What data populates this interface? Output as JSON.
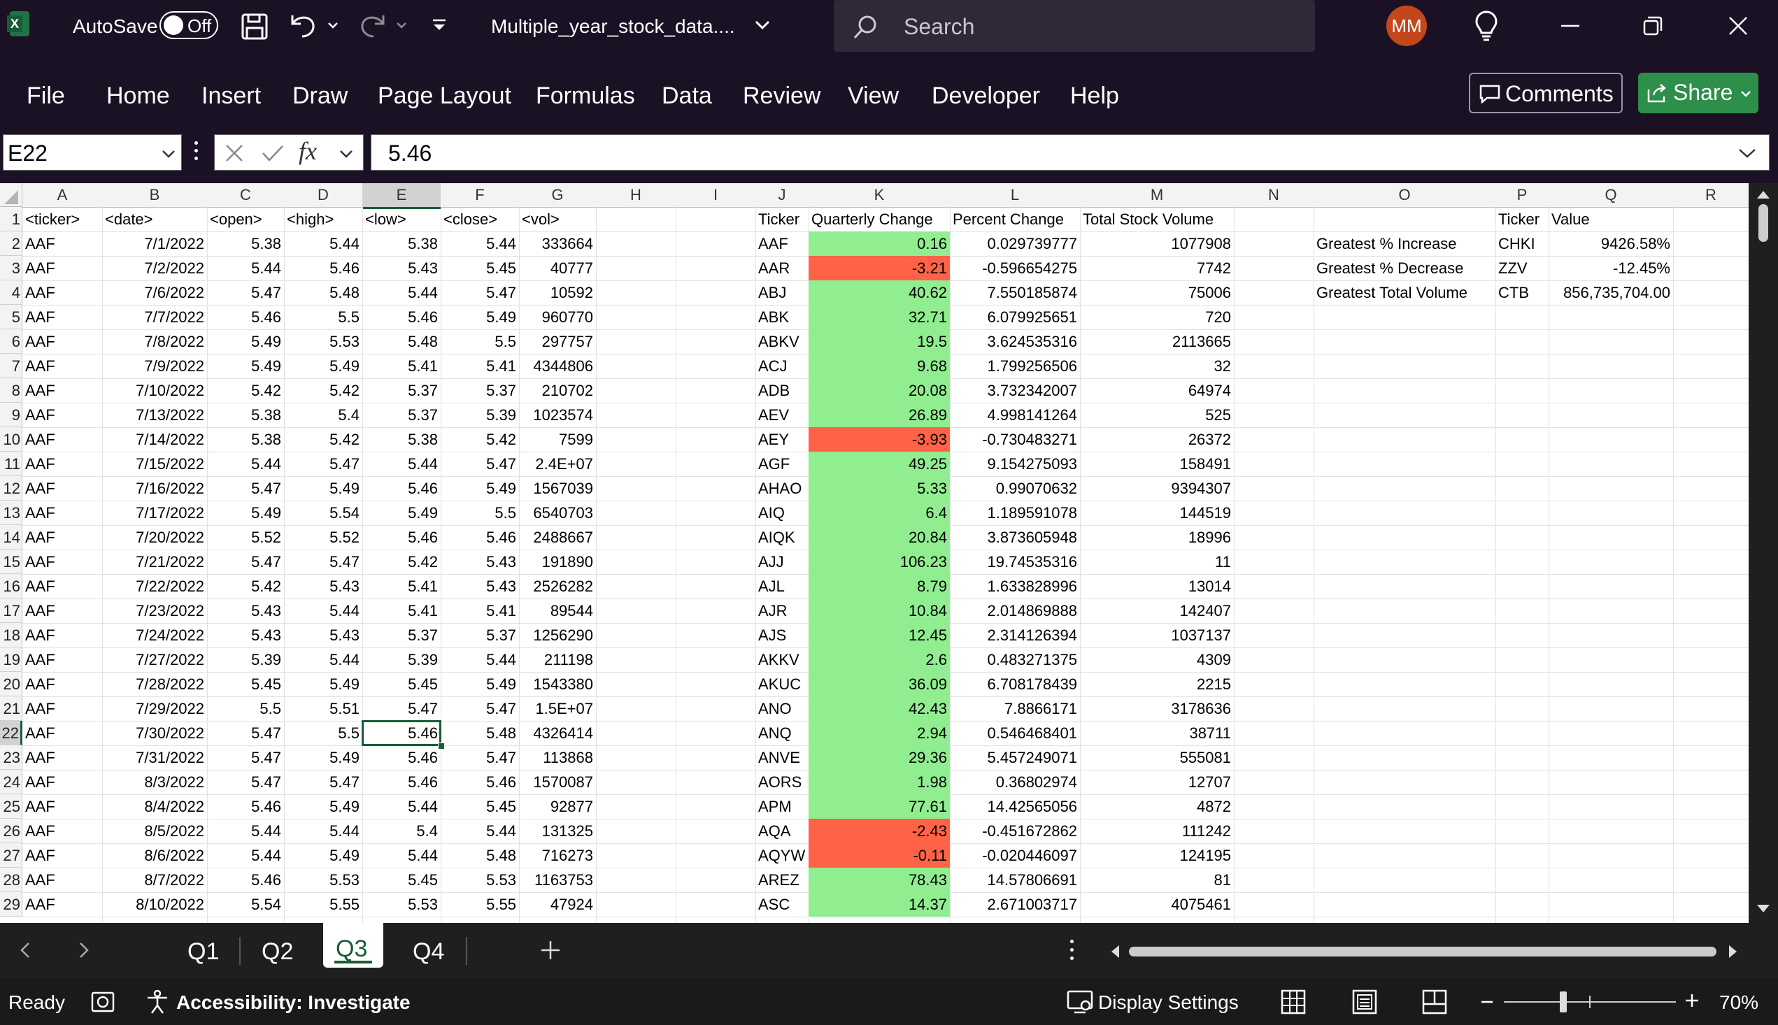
{
  "titlebar": {
    "autosave_label": "AutoSave",
    "autosave_state": "Off",
    "filename": "Multiple_year_stock_data....",
    "search_placeholder": "Search",
    "avatar_initials": "MM"
  },
  "ribbon": {
    "menu": [
      "File",
      "Home",
      "Insert",
      "Draw",
      "Page Layout",
      "Formulas",
      "Data",
      "Review",
      "View",
      "Developer",
      "Help"
    ],
    "comments_label": "Comments",
    "share_label": "Share"
  },
  "formula_bar": {
    "name_box": "E22",
    "fx": "fx",
    "value": "5.46"
  },
  "columns": [
    "A",
    "B",
    "C",
    "D",
    "E",
    "F",
    "G",
    "H",
    "I",
    "J",
    "K",
    "L",
    "M",
    "N",
    "O",
    "P",
    "Q",
    "R"
  ],
  "rows": [
    "1",
    "2",
    "3",
    "4",
    "5",
    "6",
    "7",
    "8",
    "9",
    "10",
    "11",
    "12",
    "13",
    "14",
    "15",
    "16",
    "17",
    "18",
    "19",
    "20",
    "21",
    "22",
    "23",
    "24",
    "25",
    "26",
    "27",
    "28",
    "29"
  ],
  "raw_headers": [
    "<ticker>",
    "<date>",
    "<open>",
    "<high>",
    "<low>",
    "<close>",
    "<vol>"
  ],
  "raw_data": [
    [
      "AAF",
      "7/1/2022",
      "5.38",
      "5.44",
      "5.38",
      "5.44",
      "333664"
    ],
    [
      "AAF",
      "7/2/2022",
      "5.44",
      "5.46",
      "5.43",
      "5.45",
      "40777"
    ],
    [
      "AAF",
      "7/6/2022",
      "5.47",
      "5.48",
      "5.44",
      "5.47",
      "10592"
    ],
    [
      "AAF",
      "7/7/2022",
      "5.46",
      "5.5",
      "5.46",
      "5.49",
      "960770"
    ],
    [
      "AAF",
      "7/8/2022",
      "5.49",
      "5.53",
      "5.48",
      "5.5",
      "297757"
    ],
    [
      "AAF",
      "7/9/2022",
      "5.49",
      "5.49",
      "5.41",
      "5.41",
      "4344806"
    ],
    [
      "AAF",
      "7/10/2022",
      "5.42",
      "5.42",
      "5.37",
      "5.37",
      "210702"
    ],
    [
      "AAF",
      "7/13/2022",
      "5.38",
      "5.4",
      "5.37",
      "5.39",
      "1023574"
    ],
    [
      "AAF",
      "7/14/2022",
      "5.38",
      "5.42",
      "5.38",
      "5.42",
      "7599"
    ],
    [
      "AAF",
      "7/15/2022",
      "5.44",
      "5.47",
      "5.44",
      "5.47",
      "2.4E+07"
    ],
    [
      "AAF",
      "7/16/2022",
      "5.47",
      "5.49",
      "5.46",
      "5.49",
      "1567039"
    ],
    [
      "AAF",
      "7/17/2022",
      "5.49",
      "5.54",
      "5.49",
      "5.5",
      "6540703"
    ],
    [
      "AAF",
      "7/20/2022",
      "5.52",
      "5.52",
      "5.46",
      "5.46",
      "2488667"
    ],
    [
      "AAF",
      "7/21/2022",
      "5.47",
      "5.47",
      "5.42",
      "5.43",
      "191890"
    ],
    [
      "AAF",
      "7/22/2022",
      "5.42",
      "5.43",
      "5.41",
      "5.43",
      "2526282"
    ],
    [
      "AAF",
      "7/23/2022",
      "5.43",
      "5.44",
      "5.41",
      "5.41",
      "89544"
    ],
    [
      "AAF",
      "7/24/2022",
      "5.43",
      "5.43",
      "5.37",
      "5.37",
      "1256290"
    ],
    [
      "AAF",
      "7/27/2022",
      "5.39",
      "5.44",
      "5.39",
      "5.44",
      "211198"
    ],
    [
      "AAF",
      "7/28/2022",
      "5.45",
      "5.49",
      "5.45",
      "5.49",
      "1543380"
    ],
    [
      "AAF",
      "7/29/2022",
      "5.5",
      "5.51",
      "5.47",
      "5.47",
      "1.5E+07"
    ],
    [
      "AAF",
      "7/30/2022",
      "5.47",
      "5.5",
      "5.46",
      "5.48",
      "4326414"
    ],
    [
      "AAF",
      "7/31/2022",
      "5.47",
      "5.49",
      "5.46",
      "5.47",
      "113868"
    ],
    [
      "AAF",
      "8/3/2022",
      "5.47",
      "5.47",
      "5.46",
      "5.46",
      "1570087"
    ],
    [
      "AAF",
      "8/4/2022",
      "5.46",
      "5.49",
      "5.44",
      "5.45",
      "92877"
    ],
    [
      "AAF",
      "8/5/2022",
      "5.44",
      "5.44",
      "5.4",
      "5.44",
      "131325"
    ],
    [
      "AAF",
      "8/6/2022",
      "5.44",
      "5.49",
      "5.44",
      "5.48",
      "716273"
    ],
    [
      "AAF",
      "8/7/2022",
      "5.46",
      "5.53",
      "5.45",
      "5.53",
      "1163753"
    ],
    [
      "AAF",
      "8/10/2022",
      "5.54",
      "5.55",
      "5.53",
      "5.55",
      "47924"
    ]
  ],
  "summary_headers": [
    "Ticker",
    "Quarterly Change",
    "Percent Change",
    "Total Stock Volume"
  ],
  "summary_data": [
    [
      "AAF",
      "0.16",
      "0.029739777",
      "1077908"
    ],
    [
      "AAR",
      "-3.21",
      "-0.596654275",
      "7742"
    ],
    [
      "ABJ",
      "40.62",
      "7.550185874",
      "75006"
    ],
    [
      "ABK",
      "32.71",
      "6.079925651",
      "720"
    ],
    [
      "ABKV",
      "19.5",
      "3.624535316",
      "2113665"
    ],
    [
      "ACJ",
      "9.68",
      "1.799256506",
      "32"
    ],
    [
      "ADB",
      "20.08",
      "3.732342007",
      "64974"
    ],
    [
      "AEV",
      "26.89",
      "4.998141264",
      "525"
    ],
    [
      "AEY",
      "-3.93",
      "-0.730483271",
      "26372"
    ],
    [
      "AGF",
      "49.25",
      "9.154275093",
      "158491"
    ],
    [
      "AHAO",
      "5.33",
      "0.99070632",
      "9394307"
    ],
    [
      "AIQ",
      "6.4",
      "1.189591078",
      "144519"
    ],
    [
      "AIQK",
      "20.84",
      "3.873605948",
      "18996"
    ],
    [
      "AJJ",
      "106.23",
      "19.74535316",
      "11"
    ],
    [
      "AJL",
      "8.79",
      "1.633828996",
      "13014"
    ],
    [
      "AJR",
      "10.84",
      "2.014869888",
      "142407"
    ],
    [
      "AJS",
      "12.45",
      "2.314126394",
      "1037137"
    ],
    [
      "AKKV",
      "2.6",
      "0.483271375",
      "4309"
    ],
    [
      "AKUC",
      "36.09",
      "6.708178439",
      "2215"
    ],
    [
      "ANO",
      "42.43",
      "7.8866171",
      "3178636"
    ],
    [
      "ANQ",
      "2.94",
      "0.546468401",
      "38711"
    ],
    [
      "ANVE",
      "29.36",
      "5.457249071",
      "555081"
    ],
    [
      "AORS",
      "1.98",
      "0.36802974",
      "12707"
    ],
    [
      "APM",
      "77.61",
      "14.42565056",
      "4872"
    ],
    [
      "AQA",
      "-2.43",
      "-0.451672862",
      "111242"
    ],
    [
      "AQYW",
      "-0.11",
      "-0.020446097",
      "124195"
    ],
    [
      "AREZ",
      "78.43",
      "14.57806691",
      "81"
    ],
    [
      "ASC",
      "14.37",
      "2.671003717",
      "4075461"
    ]
  ],
  "greatest_headers": [
    "Ticker",
    "Value"
  ],
  "greatest": [
    [
      "Greatest % Increase",
      "CHKI",
      "9426.58%"
    ],
    [
      "Greatest % Decrease",
      "ZZV",
      "-12.45%"
    ],
    [
      "Greatest Total Volume",
      "CTB",
      "856,735,704.00"
    ]
  ],
  "sheet_tabs": [
    "Q1",
    "Q2",
    "Q3",
    "Q4"
  ],
  "active_tab": "Q3",
  "status": {
    "ready": "Ready",
    "accessibility": "Accessibility: Investigate",
    "display_settings": "Display Settings",
    "zoom": "70%"
  },
  "colors": {
    "positive_fill": "#90ee90",
    "negative_fill": "#ff6347",
    "excel_green": "#217346",
    "avatar": "#c4461b",
    "share_bg": "#2d8f4a"
  },
  "icons": [
    "excel-logo-icon",
    "save-icon",
    "undo-icon",
    "redo-icon",
    "customize-toolbar-icon",
    "search-icon",
    "lightbulb-icon",
    "minimize-icon",
    "restore-icon",
    "close-icon",
    "comment-icon",
    "share-icon",
    "cancel-icon",
    "enter-icon",
    "fx-icon",
    "sheet-options-icon",
    "add-sheet-icon",
    "workbook-stats-icon",
    "accessibility-icon",
    "display-settings-icon",
    "normal-view-icon",
    "page-layout-view-icon",
    "page-break-view-icon"
  ]
}
